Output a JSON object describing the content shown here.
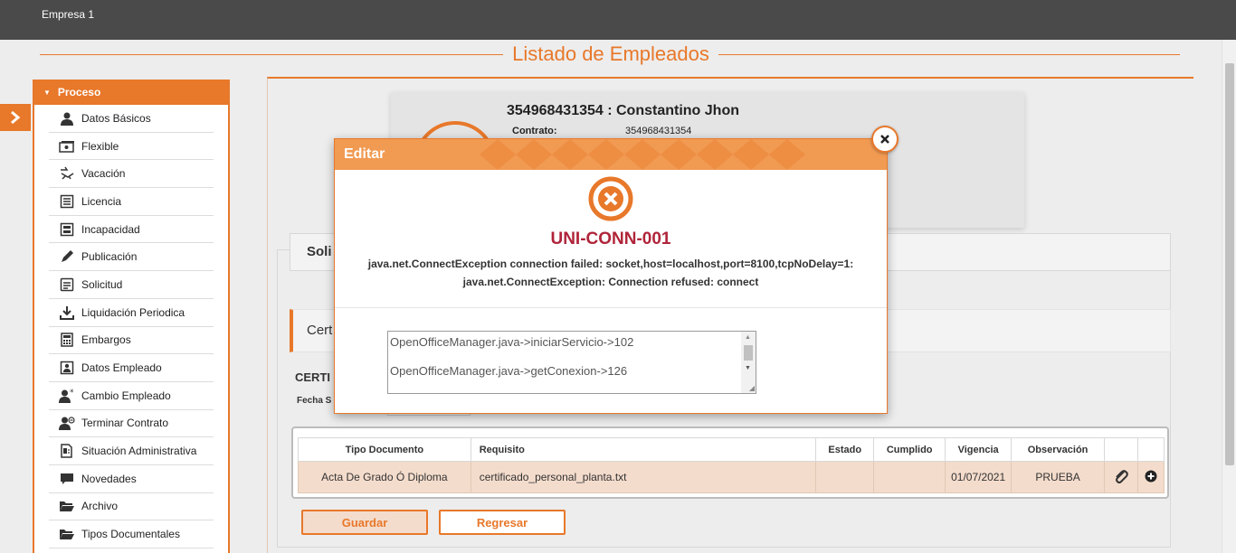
{
  "header": {
    "company": "Empresa 1"
  },
  "page": {
    "title": "Listado de Empleados"
  },
  "sidebar": {
    "heading": "Proceso",
    "items": [
      {
        "label": "Datos Básicos",
        "icon": "user-icon"
      },
      {
        "label": "Flexible",
        "icon": "money-icon"
      },
      {
        "label": "Vacación",
        "icon": "beach-chair-icon"
      },
      {
        "label": "Licencia",
        "icon": "document-list-icon"
      },
      {
        "label": "Incapacidad",
        "icon": "medical-doc-icon"
      },
      {
        "label": "Publicación",
        "icon": "pen-icon"
      },
      {
        "label": "Solicitud",
        "icon": "form-icon"
      },
      {
        "label": "Liquidación Periodica",
        "icon": "download-icon"
      },
      {
        "label": "Embargos",
        "icon": "calculator-icon"
      },
      {
        "label": "Datos Empleado",
        "icon": "id-card-icon"
      },
      {
        "label": "Cambio Empleado",
        "icon": "user-star-icon"
      },
      {
        "label": "Terminar Contrato",
        "icon": "user-remove-icon"
      },
      {
        "label": "Situación Administrativa",
        "icon": "admin-doc-icon"
      },
      {
        "label": "Novedades",
        "icon": "chat-icon"
      },
      {
        "label": "Archivo",
        "icon": "folder-open-icon"
      },
      {
        "label": "Tipos Documentales",
        "icon": "folder-open-icon"
      }
    ]
  },
  "employee": {
    "name": "354968431354 : Constantino Jhon",
    "contract_label": "Contrato:",
    "contract_value": "354968431354"
  },
  "sections": {
    "solicitud_tab": "Soli",
    "cert_tab": "Cert",
    "certi_label": "CERTI",
    "fecha_label": "Fecha S"
  },
  "table": {
    "headers": [
      "Tipo Documento",
      "Requisito",
      "Estado",
      "Cumplido",
      "Vigencia",
      "Observación",
      "",
      ""
    ],
    "rows": [
      {
        "tipo": "Acta De Grado Ó Diploma",
        "requisito": "certificado_personal_planta.txt",
        "estado": "",
        "cumplido": "",
        "vigencia": "01/07/2021",
        "observacion": "PRUEBA"
      }
    ]
  },
  "buttons": {
    "save": "Guardar",
    "back": "Regresar"
  },
  "modal": {
    "title": "Editar",
    "error_code": "UNI-CONN-001",
    "message_line1": "java.net.ConnectException connection failed: socket,host=localhost,port=8100,tcpNoDelay=1:",
    "message_line2": "java.net.ConnectException: Connection refused: connect",
    "trace": [
      "OpenOfficeManager.java->iniciarServicio->102",
      "OpenOfficeManager.java->getConexion->126"
    ]
  },
  "colors": {
    "accent": "#e8782a",
    "error": "#b0243a",
    "header_bg": "#4a4a4a",
    "modal_head": "#f19a52"
  }
}
